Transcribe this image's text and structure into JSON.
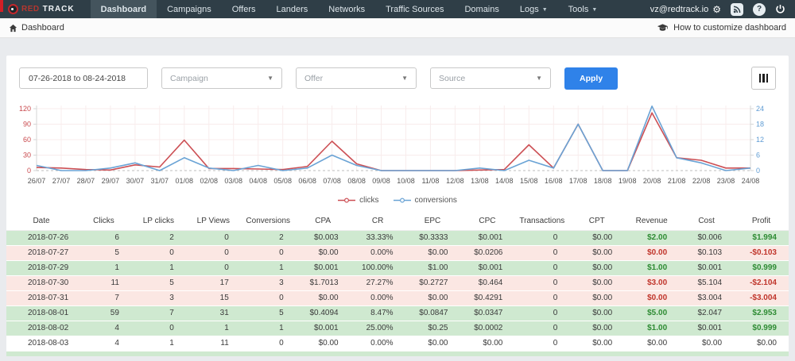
{
  "navbar": {
    "brand_red": "RED",
    "brand_track": "TRACK",
    "items": [
      {
        "label": "Dashboard",
        "active": true
      },
      {
        "label": "Campaigns"
      },
      {
        "label": "Offers"
      },
      {
        "label": "Landers"
      },
      {
        "label": "Networks"
      },
      {
        "label": "Traffic Sources"
      },
      {
        "label": "Domains"
      },
      {
        "label": "Logs",
        "caret": true
      },
      {
        "label": "Tools",
        "caret": true
      }
    ],
    "account": "vz@redtrack.io"
  },
  "breadcrumb": {
    "label": "Dashboard"
  },
  "help_link": "How to customize dashboard",
  "filters": {
    "date_range": "07-26-2018 to 08-24-2018",
    "campaign_placeholder": "Campaign",
    "offer_placeholder": "Offer",
    "source_placeholder": "Source",
    "apply_label": "Apply"
  },
  "chart_data": {
    "type": "line",
    "x": [
      "26/07",
      "27/07",
      "28/07",
      "29/07",
      "30/07",
      "31/07",
      "01/08",
      "02/08",
      "03/08",
      "04/08",
      "05/08",
      "06/08",
      "07/08",
      "08/08",
      "09/08",
      "10/08",
      "11/08",
      "12/08",
      "13/08",
      "14/08",
      "15/08",
      "16/08",
      "17/08",
      "18/08",
      "19/08",
      "20/08",
      "21/08",
      "22/08",
      "23/08",
      "24/08"
    ],
    "series": [
      {
        "name": "clicks",
        "axis": "left",
        "color": "#cc4f54",
        "values": [
          6,
          5,
          2,
          1,
          11,
          7,
          59,
          4,
          4,
          3,
          2,
          8,
          57,
          13,
          0,
          0,
          0,
          0,
          1,
          2,
          50,
          5,
          90,
          0,
          0,
          112,
          25,
          20,
          5,
          5
        ]
      },
      {
        "name": "conversions",
        "axis": "right",
        "color": "#6aa3d5",
        "values": [
          2,
          0,
          0,
          1,
          3,
          0,
          5,
          1,
          0,
          2,
          0,
          1,
          6,
          2,
          0,
          0,
          0,
          0,
          1,
          0,
          4,
          1,
          18,
          0,
          0,
          25,
          5,
          3,
          0,
          1
        ]
      }
    ],
    "left_axis": {
      "max": 120,
      "ticks": [
        0,
        30,
        60,
        90,
        120
      ],
      "color": "#c9494d"
    },
    "right_axis": {
      "max": 24,
      "ticks": [
        0,
        6,
        12,
        18,
        24
      ],
      "color": "#5e9bd3"
    },
    "legend": [
      "clicks",
      "conversions"
    ],
    "grid": true,
    "legend_position": "bottom"
  },
  "table": {
    "columns": [
      "Date",
      "Clicks",
      "LP clicks",
      "LP Views",
      "Conversions",
      "CPA",
      "CR",
      "EPC",
      "CPC",
      "Transactions",
      "CPT",
      "Revenue",
      "Cost",
      "Profit"
    ],
    "rows": [
      {
        "tone": "green",
        "value_tone": "green",
        "cells": [
          "2018-07-26",
          "6",
          "2",
          "0",
          "2",
          "$0.003",
          "33.33%",
          "$0.3333",
          "$0.001",
          "0",
          "$0.00",
          "$2.00",
          "$0.006",
          "$1.994"
        ]
      },
      {
        "tone": "pink",
        "value_tone": "red",
        "cells": [
          "2018-07-27",
          "5",
          "0",
          "0",
          "0",
          "$0.00",
          "0.00%",
          "$0.00",
          "$0.0206",
          "0",
          "$0.00",
          "$0.00",
          "$0.103",
          "-$0.103"
        ]
      },
      {
        "tone": "green",
        "value_tone": "green",
        "cells": [
          "2018-07-29",
          "1",
          "1",
          "0",
          "1",
          "$0.001",
          "100.00%",
          "$1.00",
          "$0.001",
          "0",
          "$0.00",
          "$1.00",
          "$0.001",
          "$0.999"
        ]
      },
      {
        "tone": "pink",
        "value_tone": "red",
        "cells": [
          "2018-07-30",
          "11",
          "5",
          "17",
          "3",
          "$1.7013",
          "27.27%",
          "$0.2727",
          "$0.464",
          "0",
          "$0.00",
          "$3.00",
          "$5.104",
          "-$2.104"
        ]
      },
      {
        "tone": "pink",
        "value_tone": "red",
        "cells": [
          "2018-07-31",
          "7",
          "3",
          "15",
          "0",
          "$0.00",
          "0.00%",
          "$0.00",
          "$0.4291",
          "0",
          "$0.00",
          "$0.00",
          "$3.004",
          "-$3.004"
        ]
      },
      {
        "tone": "green",
        "value_tone": "green",
        "cells": [
          "2018-08-01",
          "59",
          "7",
          "31",
          "5",
          "$0.4094",
          "8.47%",
          "$0.0847",
          "$0.0347",
          "0",
          "$0.00",
          "$5.00",
          "$2.047",
          "$2.953"
        ]
      },
      {
        "tone": "green",
        "value_tone": "green",
        "cells": [
          "2018-08-02",
          "4",
          "0",
          "1",
          "1",
          "$0.001",
          "25.00%",
          "$0.25",
          "$0.0002",
          "0",
          "$0.00",
          "$1.00",
          "$0.001",
          "$0.999"
        ]
      },
      {
        "tone": "white",
        "value_tone": "plain",
        "cells": [
          "2018-08-03",
          "4",
          "1",
          "11",
          "0",
          "$0.00",
          "0.00%",
          "$0.00",
          "$0.00",
          "0",
          "$0.00",
          "$0.00",
          "$0.00",
          "$0.00"
        ]
      }
    ]
  },
  "colors": {
    "accent_blue": "#2f82e9",
    "navbar_bg": "#2f3e47",
    "row_green": "#cfe9d0",
    "row_pink": "#fbe7e3",
    "positive_text": "#2e8b33",
    "negative_text": "#c0352b"
  }
}
